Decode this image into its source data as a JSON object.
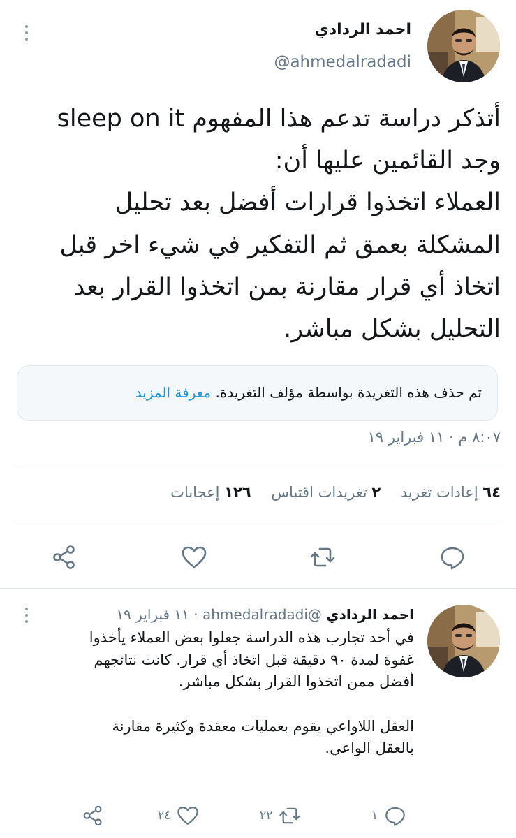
{
  "tweet": {
    "author_name": "احمد الردادي",
    "author_handle": "@ahmedalradadi",
    "body_lines": [
      "أتذكر دراسة تدعم هذا المفهوم sleep on it",
      "وجد القائمين عليها أن:",
      "العملاء اتخذوا قرارات أفضل بعد تحليل",
      "المشكلة بعمق ثم التفكير في شيء اخر قبل",
      "اتخاذ أي قرار مقارنة بمن اتخذوا القرار بعد",
      "التحليل بشكل مباشر."
    ],
    "notice_text": "تم حذف هذه التغريدة بواسطة مؤلف التغريدة.",
    "notice_link": "معرفة المزيد",
    "timestamp": "٨:٠٧ م · ١١ فبراير ١٩",
    "stats": {
      "retweets_count": "٦٤",
      "retweets_label": "إعادات تغريد",
      "quotes_count": "٢",
      "quotes_label": "تغريدات اقتباس",
      "likes_count": "١٢٦",
      "likes_label": "إعجابات"
    },
    "actions": [
      "reply-icon",
      "retweet-icon",
      "like-icon",
      "share-icon"
    ]
  },
  "reply": {
    "author_name": "احمد الردادي",
    "author_handle": "@ahmedalradadi",
    "date": "· ١١ فبراير ١٩",
    "body_lines_1": [
      "في أحد تجارب هذه الدراسة جعلوا بعض العملاء يأخذوا",
      "غفوة لمدة ٩٠ دقيقة قبل اتخاذ أي قرار. كانت نتائجهم",
      "أفضل ممن اتخذوا القرار بشكل مباشر."
    ],
    "body_lines_2": [
      "العقل اللاواعي يقوم بعمليات معقدة وكثيرة مقارنة",
      "بالعقل الواعي."
    ],
    "replies_count": "١",
    "retweets_count": "٢٢",
    "likes_count": "٢٤"
  },
  "colors": {
    "text": "#14171a",
    "secondary": "#657786",
    "link": "#1b95e0",
    "divider": "#e1e8ed",
    "icon": "#657786"
  }
}
